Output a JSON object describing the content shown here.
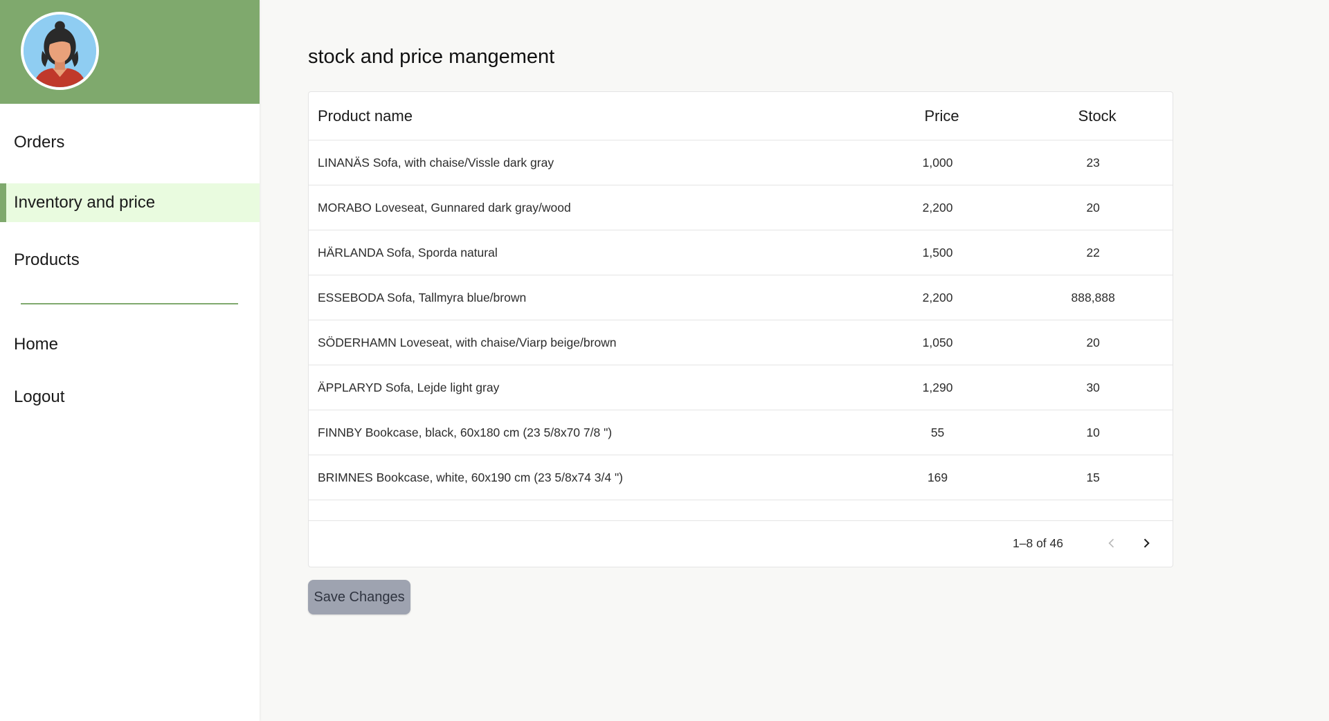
{
  "sidebar": {
    "avatar_icon": "female-user-avatar-icon",
    "items": [
      {
        "label": "Orders"
      },
      {
        "label": "Inventory and price"
      },
      {
        "label": "Products"
      },
      {
        "label": "Home"
      },
      {
        "label": "Logout"
      }
    ],
    "active_index": 1
  },
  "colors": {
    "brand_green": "#7fa96d",
    "active_bg": "#e9fbdf",
    "save_button_bg": "#9ea3b0"
  },
  "main": {
    "title": "stock and price mangement",
    "table": {
      "columns": [
        "Product name",
        "Price",
        "Stock"
      ],
      "rows": [
        {
          "name": "LINANÄS Sofa, with chaise/Vissle dark gray",
          "price": "1,000",
          "stock": "23"
        },
        {
          "name": "MORABO Loveseat, Gunnared dark gray/wood",
          "price": "2,200",
          "stock": "20"
        },
        {
          "name": "HÄRLANDA Sofa, Sporda natural",
          "price": "1,500",
          "stock": "22"
        },
        {
          "name": "ESSEBODA Sofa, Tallmyra blue/brown",
          "price": "2,200",
          "stock": "888,888"
        },
        {
          "name": "SÖDERHAMN Loveseat, with chaise/Viarp beige/brown",
          "price": "1,050",
          "stock": "20"
        },
        {
          "name": "ÄPPLARYD Sofa, Lejde light gray",
          "price": "1,290",
          "stock": "30"
        },
        {
          "name": "FINNBY Bookcase, black, 60x180 cm (23 5/8x70 7/8 \")",
          "price": "55",
          "stock": "10"
        },
        {
          "name": "BRIMNES Bookcase, white, 60x190 cm (23 5/8x74 3/4 \")",
          "price": "169",
          "stock": "15"
        }
      ]
    },
    "pagination": {
      "range_text": "1–8 of 46",
      "prev_icon": "chevron-left-icon",
      "next_icon": "chevron-right-icon"
    },
    "save_label": "Save Changes"
  }
}
